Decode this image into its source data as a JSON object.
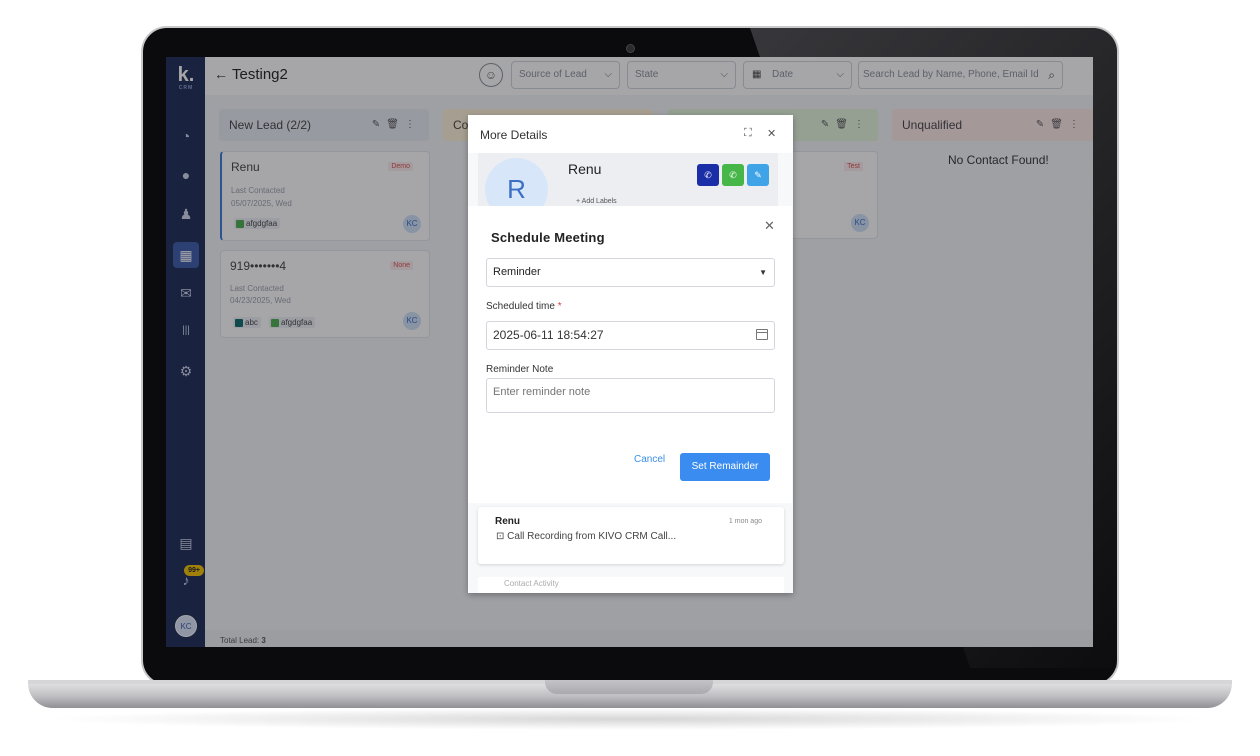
{
  "app": {
    "logo": "k.",
    "logo_sub": "CRM",
    "notif_badge": "99+",
    "user_initials": "KC"
  },
  "header": {
    "back_icon": "←",
    "title": "Testing2",
    "source_placeholder": "Source of Lead",
    "state_placeholder": "State",
    "date_placeholder": "Date",
    "search_placeholder": "Search Lead by Name, Phone, Email Id"
  },
  "board": {
    "columns": [
      {
        "title": "New Lead (2/2)",
        "color": "#e9ecf2"
      },
      {
        "title": "Co",
        "color": "#fff4d8"
      },
      {
        "title": "",
        "color": "#e4f5dc"
      },
      {
        "title": "Unqualified",
        "color": "#fde8e6"
      }
    ],
    "cards": [
      {
        "name": "Renu",
        "tag": "Demo",
        "last_contacted_label": "Last Contacted",
        "date": "05/07/2025, Wed",
        "labels": [
          {
            "text": "afgdgfaa",
            "color": "#4caf50"
          }
        ],
        "owner": "KC"
      },
      {
        "name": "919•••••••4",
        "tag": "None",
        "last_contacted_label": "Last Contacted",
        "date": "04/23/2025, Wed",
        "labels": [
          {
            "text": "abc",
            "color": "#0f6b6b"
          },
          {
            "text": "afgdgfaa",
            "color": "#4caf50"
          }
        ],
        "owner": "KC"
      }
    ],
    "third_col_tag": "Test",
    "third_col_owner": "KC",
    "empty_text": "No Contact Found!",
    "total_label": "Total Lead:",
    "total_value": "3"
  },
  "more_details": {
    "title": "More Details",
    "avatar_letter": "R",
    "name": "Renu",
    "add_labels": "+ Add Labels",
    "activity": {
      "who": "Renu",
      "time": "1 mon ago",
      "message": "Call Recording from KIVO CRM Call..."
    },
    "next_section": "Contact Activity"
  },
  "modal": {
    "title": "Schedule Meeting",
    "type_value": "Reminder",
    "scheduled_label": "Scheduled time",
    "required_mark": "*",
    "scheduled_value": "2025-06-11 18:54:27",
    "note_label": "Reminder Note",
    "note_placeholder": "Enter reminder note",
    "cancel": "Cancel",
    "submit": "Set Remainder"
  }
}
